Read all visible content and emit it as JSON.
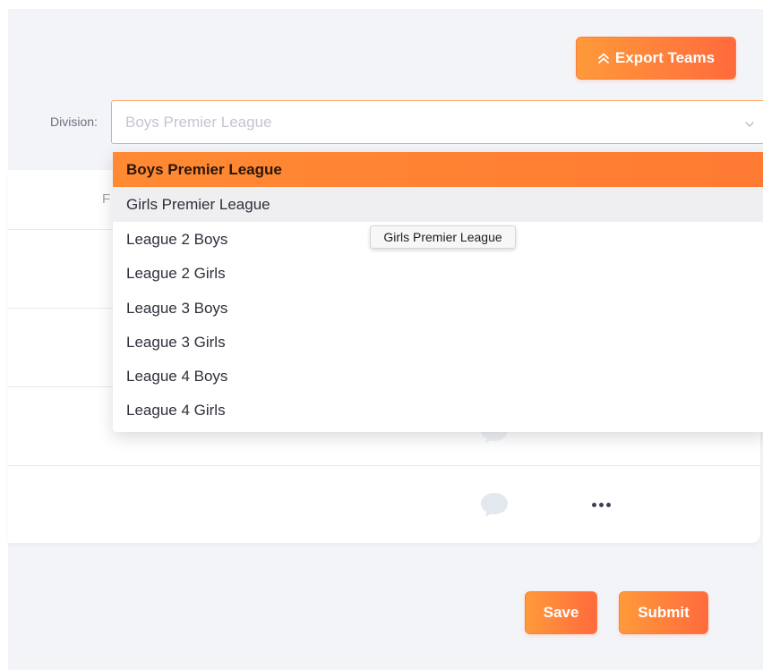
{
  "toolbar": {
    "export_label": "Export Teams",
    "export_icon": "double-chevron-up-icon"
  },
  "filter": {
    "division_label": "Division:",
    "division_value": "Boys Premier League",
    "chevron_icon": "chevron-down-icon"
  },
  "dropdown": {
    "options": [
      {
        "label": "Boys Premier League",
        "state": "selected"
      },
      {
        "label": "Girls Premier League",
        "state": "hover"
      },
      {
        "label": "League 2 Boys",
        "state": ""
      },
      {
        "label": "League 2 Girls",
        "state": ""
      },
      {
        "label": "League 3 Boys",
        "state": ""
      },
      {
        "label": "League 3 Girls",
        "state": ""
      },
      {
        "label": "League 4 Boys",
        "state": ""
      },
      {
        "label": "League 4 Girls",
        "state": ""
      }
    ]
  },
  "tooltip": {
    "text": "Girls Premier League"
  },
  "table": {
    "partial_header_text": "F",
    "row_icons": [
      "comment-icon",
      "more-options-icon"
    ]
  },
  "footer": {
    "save_label": "Save",
    "submit_label": "Submit"
  },
  "colors": {
    "accent_start": "#ff9a3a",
    "accent_end": "#ff6a3d",
    "selected_option": "#ff8a33",
    "hover_option": "#efeff1",
    "page_background": "#f3f4f8"
  }
}
